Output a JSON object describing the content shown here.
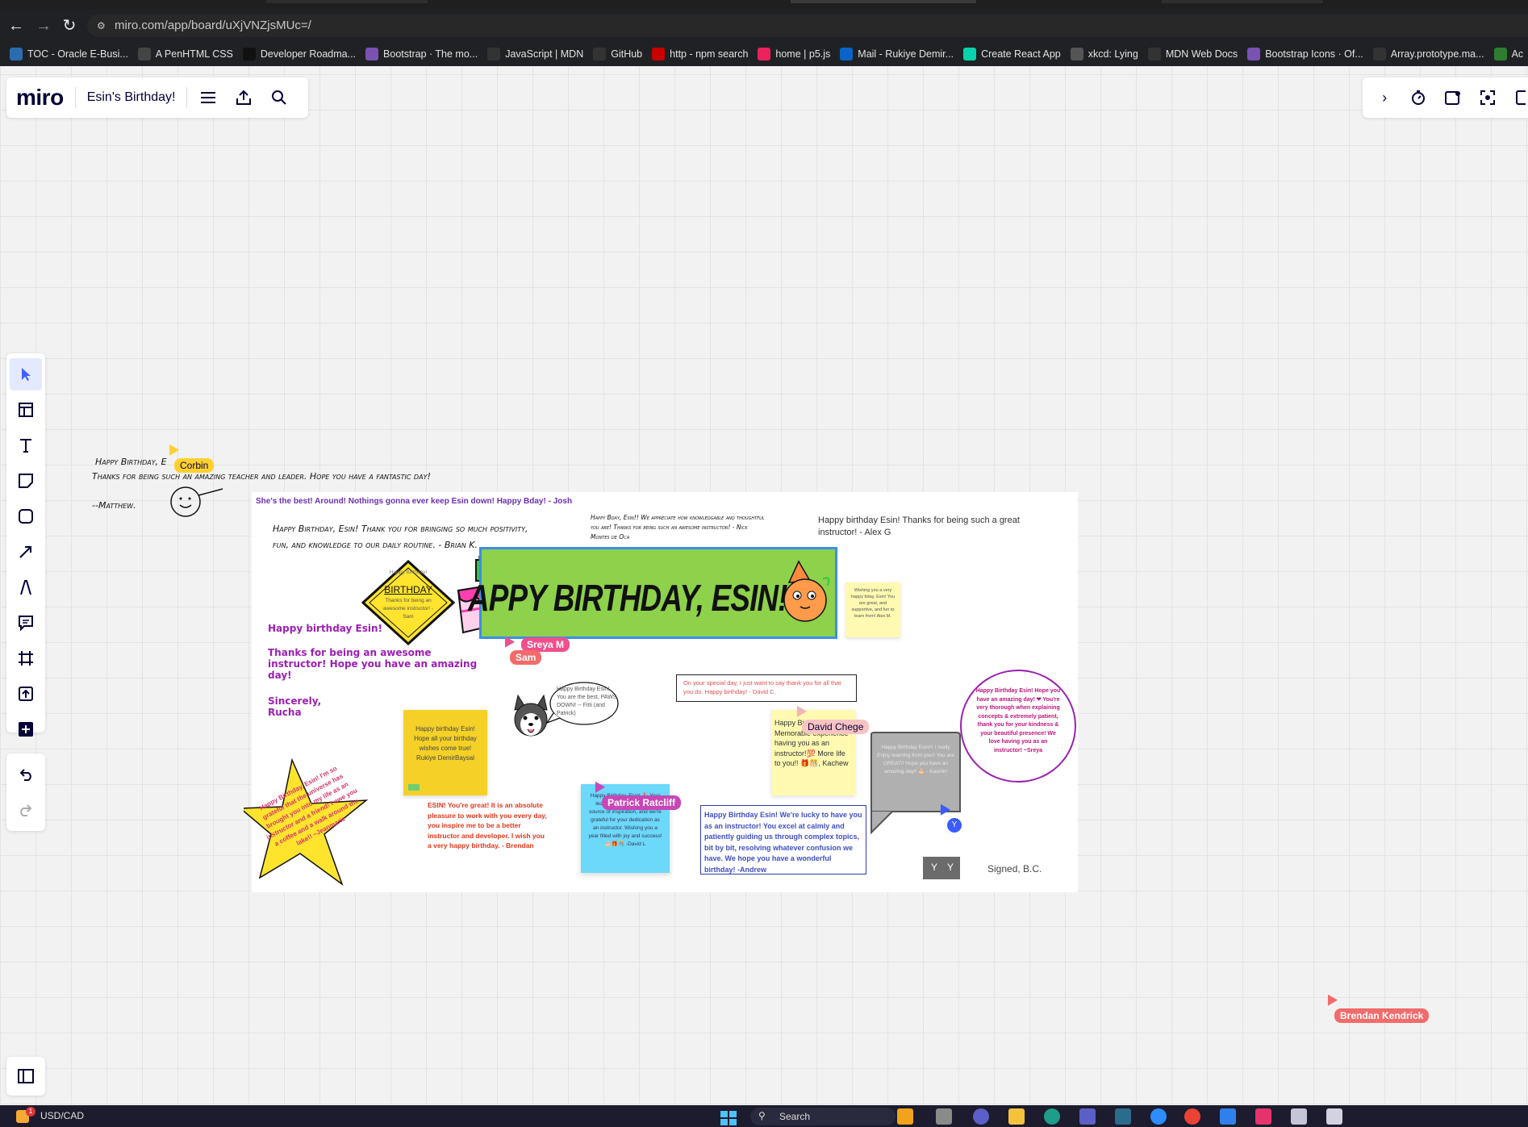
{
  "browser": {
    "url": "miro.com/app/board/uXjVNZjsMUc=/",
    "bookmarks": [
      {
        "label": "TOC - Oracle E-Busi...",
        "color": "#2b6cb0"
      },
      {
        "label": "A PenHTML CSS",
        "color": "#444444"
      },
      {
        "label": "Developer Roadma...",
        "color": "#111111"
      },
      {
        "label": "Bootstrap · The mo...",
        "color": "#7952b3"
      },
      {
        "label": "JavaScript | MDN",
        "color": "#333333"
      },
      {
        "label": "GitHub",
        "color": "#333333"
      },
      {
        "label": "http - npm search",
        "color": "#cb0000"
      },
      {
        "label": "home | p5.js",
        "color": "#ed225d"
      },
      {
        "label": "Mail - Rukiye Demir...",
        "color": "#0a64c8"
      },
      {
        "label": "Create React App",
        "color": "#09d3ac"
      },
      {
        "label": "xkcd: Lying",
        "color": "#555555"
      },
      {
        "label": "MDN Web Docs",
        "color": "#333333"
      },
      {
        "label": "Bootstrap Icons · Of...",
        "color": "#7952b3"
      },
      {
        "label": "Array.prototype.ma...",
        "color": "#333333"
      },
      {
        "label": "Ac",
        "color": "#2e7d32"
      }
    ]
  },
  "miro": {
    "logo": "miro",
    "board_name": "Esin's Birthday!"
  },
  "board": {
    "banner": "APPY BIRTHDAY, ESIN!",
    "notes": {
      "matthew": "Happy Birthday, E",
      "matthew2": "Thanks for being such an amazing teacher and leader. Hope you have a fantastic day!",
      "matthew3": "--Matthew.",
      "josh": "She's the best! Around! Nothings gonna ever keep Esin down! Happy Bday! - Josh",
      "brian": "Happy Birthday, Esin! Thank you for bringing so much positivity, fun, and knowledge to our daily routine. - Brian K.",
      "nick": "Happy Bday, Esin!! We appreciate how knowledgable and thoughtful you are! Thanks for being such an awesome instructor! - Nick Montes de Oca",
      "alexg": "Happy birthday Esin! Thanks for being such a great instructor! - Alex G",
      "diamond_top": "Happy Birthday!",
      "diamond_title": "BIRTHDAY",
      "diamond_body": "Thanks for being an awesome instructor! - Sam",
      "rucha1": "Happy birthday Esin!",
      "rucha2": "Thanks for being an awesome instructor! Hope you have an amazing day!",
      "rucha3": "Sincerely, Rucha",
      "alexm": "Wishing you a very happy bday, Esin! You are great, and supportive, and fun to learn from! Alex M.",
      "husky_bubble": "Happy Birthday Esin! You are the best, PAWS DOWN! -- Fitti (and Patrick)",
      "davidc": "On your special day, I just want to say thank you for all that you do. Happy birthday! - David C.",
      "sreya": "Happy Birthday Esin! Hope you have an amazing day! ❤ You're very thorough when explaining concepts & extremely patient, thank you for your kindness & your beautiful presence! We love having you as an instructor! ~Sreya",
      "rukiye": "Happy birthday Esin! Hope all your birthday wishes come true! Rukiye DemirBaysal",
      "kachew": "Happy Birthday Esin! Memorable experience having you as an instructor!💯 More life to you!! 🎁🎊, Kachew",
      "kasmin": "Happy Birthday Esin!!! I really Enjoy learning from you!! You are GREAT!! Hope you have an amazing day!! 🎂 - Kasmin",
      "star": "Happy Birthday, Esin! I'm so grateful that the universe has brought you into my life as an instructor and a friend! I owe you a coffee and a walk around the lake!! ~Jeanmarie",
      "brendan": "ESIN! You're great! It is an absolute pleasure to work with you every day, you inspire me to be a better instructor and developer. I wish you a very happy birthday. - Brendan",
      "davidl": "Happy Birthday, Esin! 🎉 Your lectures have been a true source of inspiration, and we're grateful for your dedication as an instructor. Wishing you a year filled with joy and success! 🎂🎁🎊 -David L",
      "andrew": "Happy Birthday Esin! We're lucky to have you as an instructor! You excel at calmly and patiently guiding us through complex topics, bit by bit, resolving whatever confusion we have. We hope you have a wonderful birthday! -Andrew",
      "signed": "Signed, B.C.",
      "yy1": "Y",
      "yy2": "Y"
    },
    "cursors": {
      "corbin": "Corbin",
      "sreya": "Sreya M",
      "sam": "Sam",
      "david": "David Chege",
      "patrick": "Patrick Ratcliff",
      "brendan": "Brendan Kendrick",
      "y_badge": "Y"
    }
  },
  "taskbar": {
    "ticker": "USD/CAD",
    "badge": "1",
    "search": "Search"
  }
}
